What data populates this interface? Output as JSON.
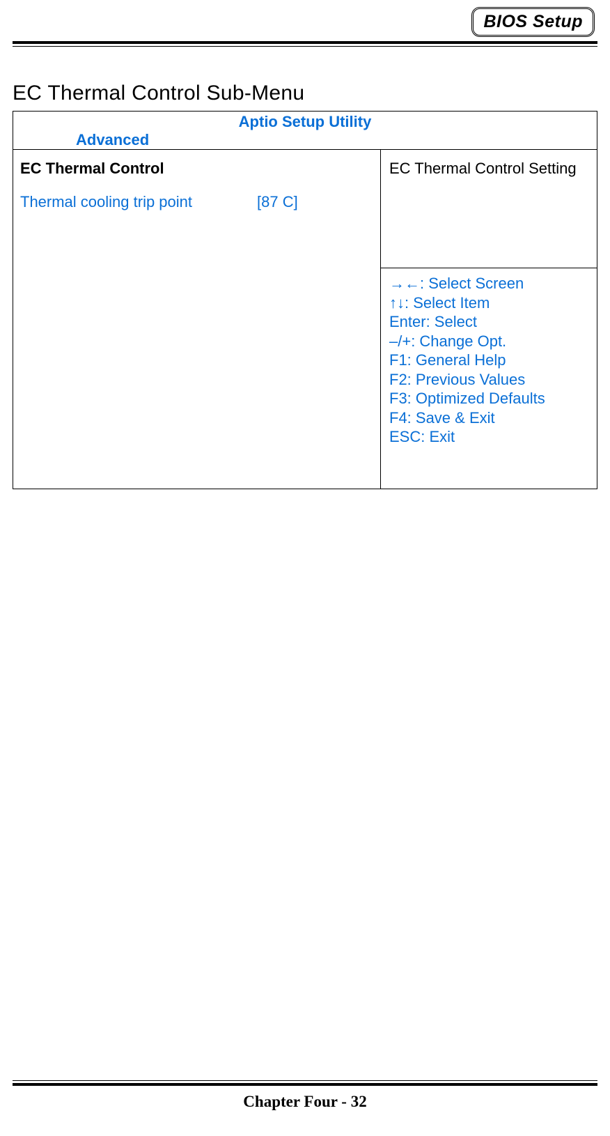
{
  "header": {
    "badge": "BIOS Setup"
  },
  "section": {
    "title": "EC Thermal Control Sub-Menu"
  },
  "bios": {
    "title": "Aptio Setup Utility",
    "active_tab": "Advanced",
    "group_title": "EC Thermal Control",
    "setting": {
      "label": "Thermal cooling trip point",
      "value": "[87 C]"
    },
    "description": "EC Thermal Control Setting",
    "help": [
      "→←: Select Screen",
      "↑↓: Select Item",
      "Enter: Select",
      "–/+: Change Opt.",
      "F1: General Help",
      "F2: Previous Values",
      "F3: Optimized Defaults",
      "F4: Save & Exit",
      "ESC: Exit"
    ]
  },
  "footer": {
    "text": "Chapter Four - 32"
  }
}
